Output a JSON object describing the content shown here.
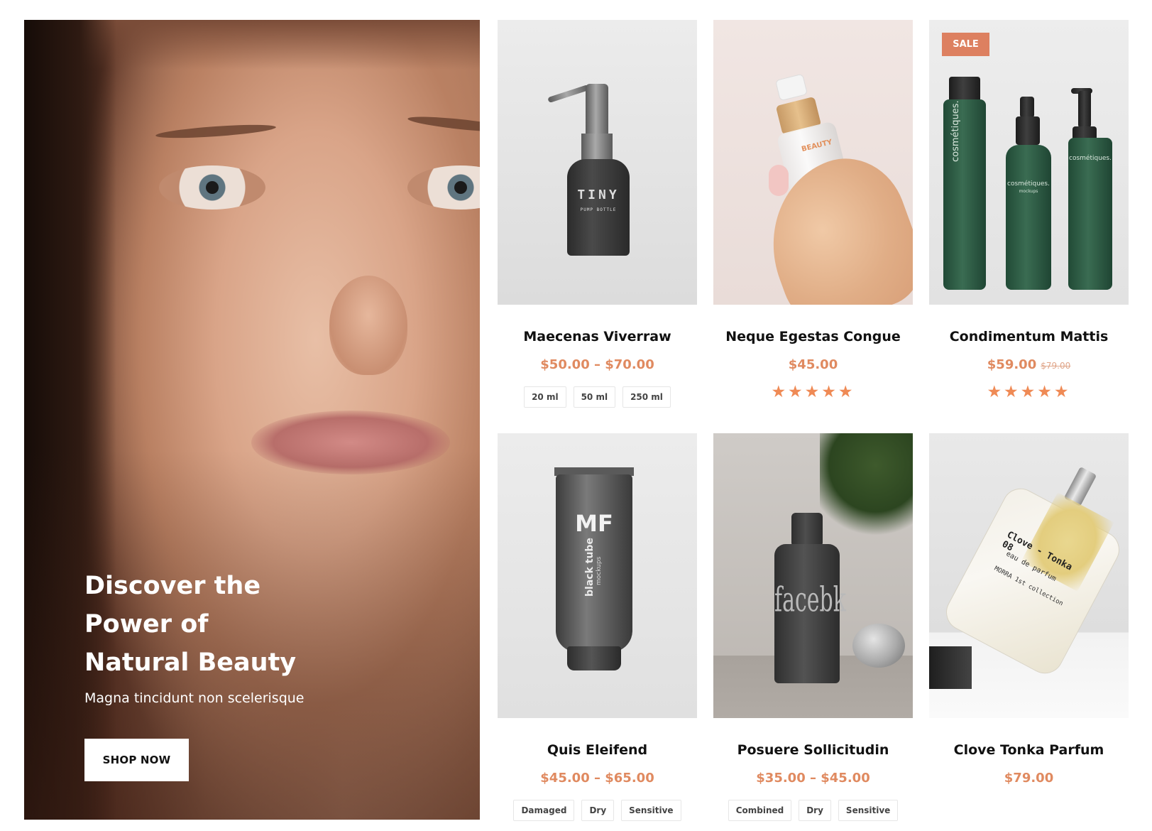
{
  "hero": {
    "title": "Discover the Power of Natural Beauty",
    "subtitle": "Magna tincidunt non scelerisque",
    "button": "SHOP NOW"
  },
  "products": [
    {
      "name": "Maecenas Viverraw",
      "price": "$50.00 – $70.00",
      "options": [
        "20 ml",
        "50 ml",
        "250 ml"
      ],
      "image_text": {
        "brand": "TINY",
        "line": "PUMP BOTTLE"
      }
    },
    {
      "name": "Neque Egestas Congue",
      "price": "$45.00",
      "rating": "★★★★★",
      "image_text": {
        "label": "BEAUTY"
      }
    },
    {
      "name": "Condimentum Mattis",
      "price": "$59.00",
      "old_price": "$79.00",
      "badge": "SALE",
      "rating": "★★★★★",
      "image_text": {
        "brand": "cosmétiques.",
        "sub": "mockups"
      }
    },
    {
      "name": "Quis Eleifend",
      "price": "$45.00 – $65.00",
      "options": [
        "Damaged",
        "Dry",
        "Sensitive"
      ],
      "image_text": {
        "logo": "MF",
        "brand": "black tube",
        "sub": "mockups"
      }
    },
    {
      "name": "Posuere Sollicitudin",
      "price": "$35.00 – $45.00",
      "options": [
        "Combined",
        "Dry",
        "Sensitive"
      ],
      "image_text": {
        "brand": "facebk"
      }
    },
    {
      "name": "Clove Tonka Parfum",
      "price": "$79.00",
      "image_text": {
        "title": "Clove - Tonka 08",
        "line1": "eau de parfum",
        "line2": "MORRA 1st collection"
      }
    }
  ],
  "colors": {
    "accent": "#e08a60",
    "sale_badge": "#dd8060",
    "stars": "#ef8a55"
  }
}
